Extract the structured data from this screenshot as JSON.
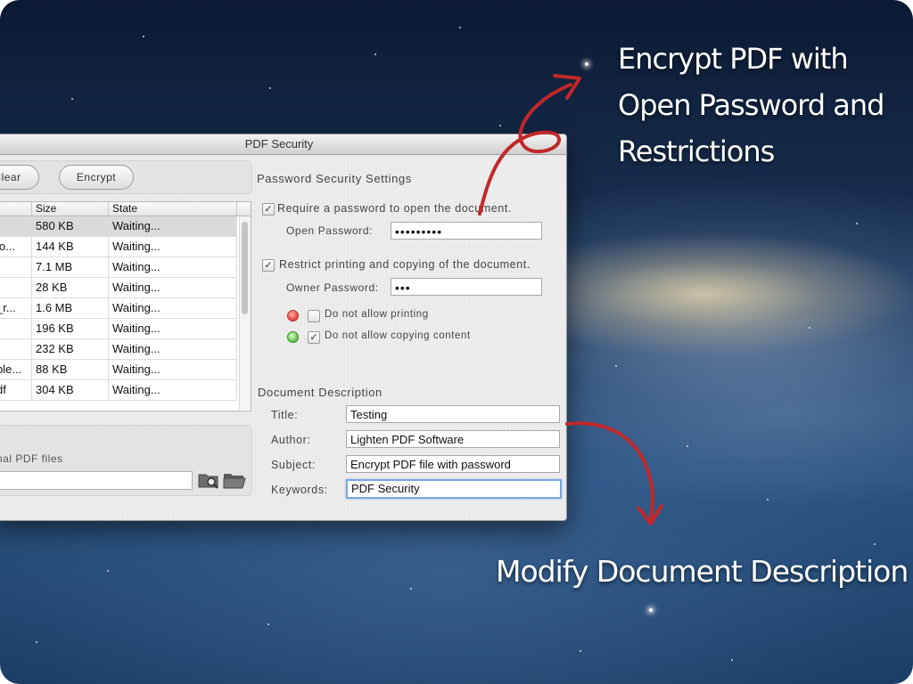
{
  "window": {
    "title": "PDF Security"
  },
  "toolbar": {
    "clear_label": "Clear",
    "encrypt_label": "Encrypt"
  },
  "table": {
    "columns": [
      "",
      "Size",
      "State"
    ],
    "rows": [
      {
        "name": "",
        "size": "580 KB",
        "state": "Waiting..."
      },
      {
        "name": "io...",
        "size": "144 KB",
        "state": "Waiting..."
      },
      {
        "name": "",
        "size": "7.1 MB",
        "state": "Waiting..."
      },
      {
        "name": "",
        "size": "28 KB",
        "state": "Waiting..."
      },
      {
        "name": "_r...",
        "size": "1.6 MB",
        "state": "Waiting..."
      },
      {
        "name": "",
        "size": "196 KB",
        "state": "Waiting..."
      },
      {
        "name": "",
        "size": "232 KB",
        "state": "Waiting..."
      },
      {
        "name": "ble...",
        "size": "88 KB",
        "state": "Waiting..."
      },
      {
        "name": "df",
        "size": "304 KB",
        "state": "Waiting..."
      }
    ]
  },
  "output": {
    "label": "nal PDF files",
    "path": ""
  },
  "security": {
    "heading": "Password Security Settings",
    "require_open_label": "Require a password to open the document.",
    "require_open_checked": "✓",
    "open_password_label": "Open Password:",
    "open_password_value": "•••••••••",
    "restrict_label": "Restrict printing and copying of the document.",
    "restrict_checked": "✓",
    "owner_password_label": "Owner Password:",
    "owner_password_value": "•••",
    "no_print_label": "Do not allow printing",
    "no_print_checked": "",
    "no_copy_label": "Do not allow copying content",
    "no_copy_checked": "✓"
  },
  "description": {
    "heading": "Document Description",
    "title_label": "Title:",
    "title_value": "Testing",
    "author_label": "Author:",
    "author_value": "Lighten PDF Software",
    "subject_label": "Subject:",
    "subject_value": "Encrypt PDF file with password",
    "keywords_label": "Keywords:",
    "keywords_value": "PDF Security"
  },
  "captions": {
    "top_line1": "Encrypt PDF with",
    "top_line2": "Open Password and",
    "top_line3": "Restrictions",
    "bottom": "Modify Document Description"
  },
  "colors": {
    "arrow": "#c0282a",
    "focus_ring": "#7aa7e0",
    "window_bg": "#ececec"
  },
  "icons": [
    "search-folder-icon",
    "folder-icon",
    "checkmark-icon"
  ]
}
